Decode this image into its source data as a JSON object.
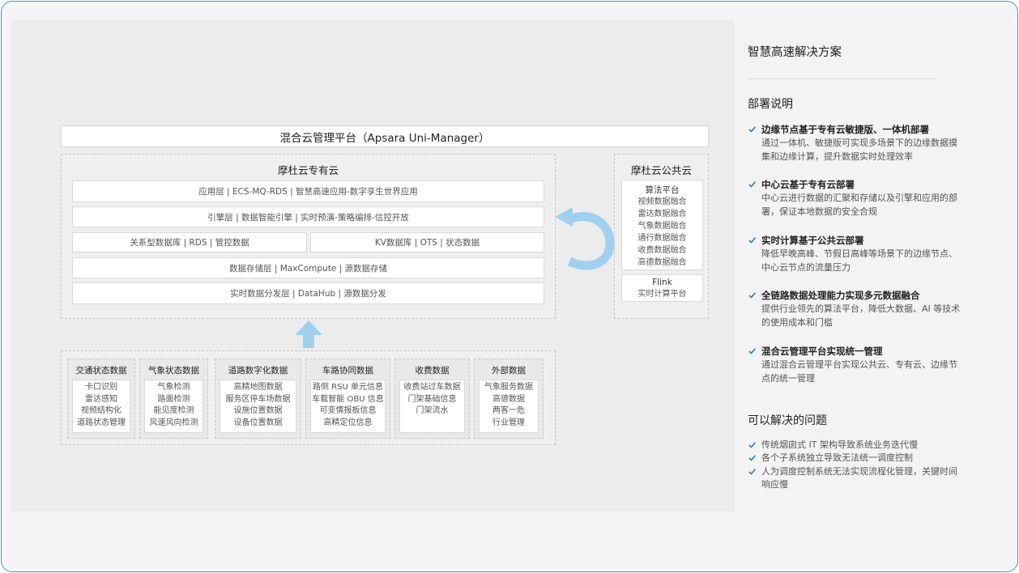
{
  "manager_bar": "混合云管理平台（Apsara Uni-Manager）",
  "private_cloud": {
    "title": "摩杜云专有云",
    "layers": [
      "应用层 | ECS-MQ-RDS | 智慧高速应用-数字孪生世界应用",
      "引擎层 | 数据智能引擎 | 实时预演-策略编排-信控开放",
      "关系型数据库 | RDS | 管控数据",
      "KV数据库 | OTS | 状态数据",
      "数据存储层 | MaxCompute | 源数据存储",
      "实时数据分发层 | DataHub | 源数据分发"
    ]
  },
  "public_cloud": {
    "title": "摩杜云公共云",
    "algo_title": "算法平台",
    "algo_items": [
      "视频数据融合",
      "雷达数据融合",
      "气象数据融合",
      "通行数据融合",
      "收费数据融合",
      "高德数据融合"
    ],
    "flink_title": "Flink",
    "flink_items": [
      "实时计算平台"
    ]
  },
  "sources": [
    {
      "title": "交通状态数据",
      "items": [
        "卡口识别",
        "雷达感知",
        "视频结构化",
        "道路状态管理"
      ]
    },
    {
      "title": "气象状态数据",
      "items": [
        "气象检测",
        "路面检测",
        "能见度检测",
        "风速风向检测"
      ]
    },
    {
      "title": "道路数字化数据",
      "items": [
        "高精地图数据",
        "服务区停车场数据",
        "设施位置数据",
        "设备位置数据"
      ]
    },
    {
      "title": "车路协同数据",
      "items": [
        "路侧 RSU 单元信息",
        "车载智能 OBU 信息",
        "可变情报板信息",
        "高精定位信息"
      ]
    },
    {
      "title": "收费数据",
      "items": [
        "收费站过车数据",
        "门架基础信息",
        "门架流水"
      ]
    },
    {
      "title": "外部数据",
      "items": [
        "气象服务数据",
        "高德数据",
        "两客一危",
        "行业管理"
      ]
    }
  ],
  "panel": {
    "title": "智慧高速解决方案",
    "deploy_heading": "部署说明",
    "deploy_items": [
      {
        "title": "边缘节点基于专有云敏捷版、一体机部署",
        "lines": [
          "通过一体机、敏捷版可实现多场景下的边缘数据摸",
          "集和边缘计算，提升数据实时处理效率"
        ]
      },
      {
        "title": "中心云基于专有云部署",
        "lines": [
          "中心云进行数据的汇聚和存储以及引擎和应用的部",
          "署，保证本地数据的安全合规"
        ]
      },
      {
        "title": "实时计算基于公共云部署",
        "lines": [
          "降低早晚高峰、节假日高峰等场景下的边缘节点、",
          "中心云节点的流量压力"
        ]
      },
      {
        "title": "全链路数据处理能力实现多元数据融合",
        "lines": [
          "提供行业领先的算法平台，降低大数据、AI  等技术",
          "的使用成本和门槛"
        ]
      },
      {
        "title": "混合云管理平台实现统一管理",
        "lines": [
          "通过混合云管理平台实现公共云、专有云、边缘节",
          "点的统一管理"
        ]
      }
    ],
    "problems_heading": "可以解决的问题",
    "problems": [
      {
        "lines": [
          "传统烟囱式 IT 架构导致系统业务迭代慢"
        ]
      },
      {
        "lines": [
          "各个子系统独立导致无法统一调度控制"
        ]
      },
      {
        "lines": [
          "人为调度控制系统无法实现流程化管理，关键时间",
          "响应慢"
        ]
      }
    ]
  },
  "colors": {
    "accent": "#2f7ec6",
    "arrow": "#9fd0ee",
    "frame": "#3a9ad9"
  }
}
